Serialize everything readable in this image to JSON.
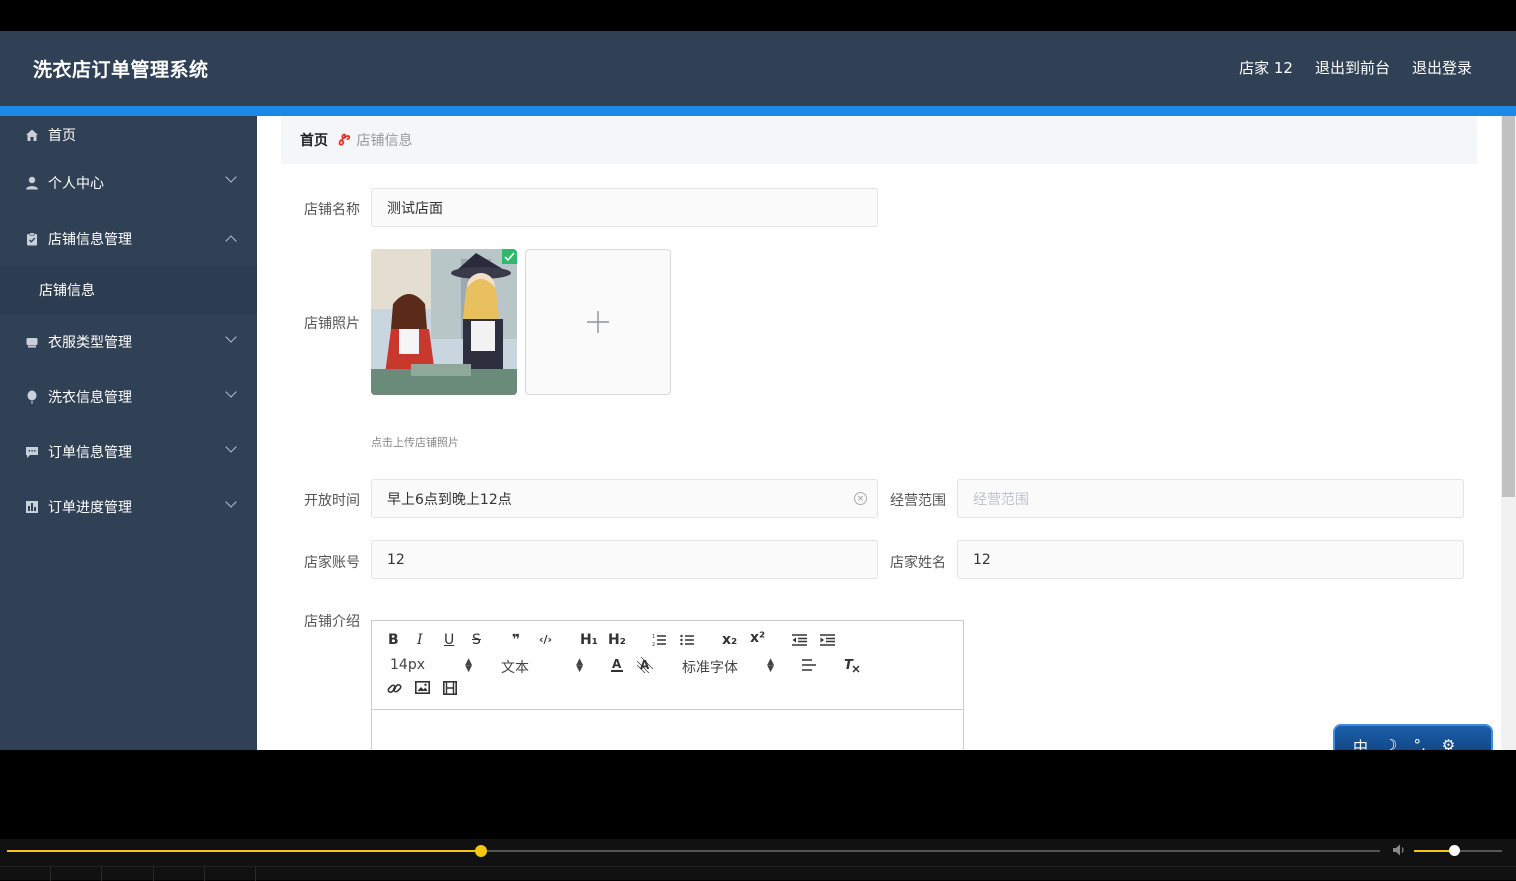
{
  "app": {
    "title": "洗衣店订单管理系统",
    "user_label": "店家 12",
    "to_front_label": "退出到前台",
    "logout_label": "退出登录"
  },
  "sidebar": {
    "items": [
      {
        "label": "首页",
        "icon": "home-icon"
      },
      {
        "label": "个人中心",
        "icon": "user-icon"
      },
      {
        "label": "店铺信息管理",
        "icon": "clipboard-icon"
      },
      {
        "label": "店铺信息",
        "icon": ""
      },
      {
        "label": "衣服类型管理",
        "icon": "tshirt-icon"
      },
      {
        "label": "洗衣信息管理",
        "icon": "balloon-icon"
      },
      {
        "label": "订单信息管理",
        "icon": "chat-icon"
      },
      {
        "label": "订单进度管理",
        "icon": "chart-icon"
      }
    ]
  },
  "breadcrumb": {
    "home": "首页",
    "separator": "Ꮡ",
    "current": "店铺信息"
  },
  "form": {
    "shop_name_label": "店铺名称",
    "shop_name_value": "测试店面",
    "shop_photo_label": "店铺照片",
    "upload_tip": "点击上传店铺照片",
    "open_time_label": "开放时间",
    "open_time_value": "早上6点到晚上12点",
    "scope_label": "经营范围",
    "scope_placeholder": "经营范围",
    "account_label": "店家账号",
    "account_value": "12",
    "owner_name_label": "店家姓名",
    "owner_name_value": "12",
    "intro_label": "店铺介绍"
  },
  "editor": {
    "bold": "B",
    "italic": "I",
    "underline": "U",
    "strike": "S",
    "quote": "❞",
    "code": "‹/›",
    "h1": "H₁",
    "h2": "H₂",
    "sub": "x₂",
    "sup": "x²",
    "size_value": "14px",
    "header_value": "文本",
    "font_value": "标准字体"
  },
  "ime": {
    "lang": "中",
    "moon": "☽",
    "dots": "°,",
    "gear": "⚙"
  },
  "player": {
    "progress": 0.345,
    "volume": 0.45
  }
}
